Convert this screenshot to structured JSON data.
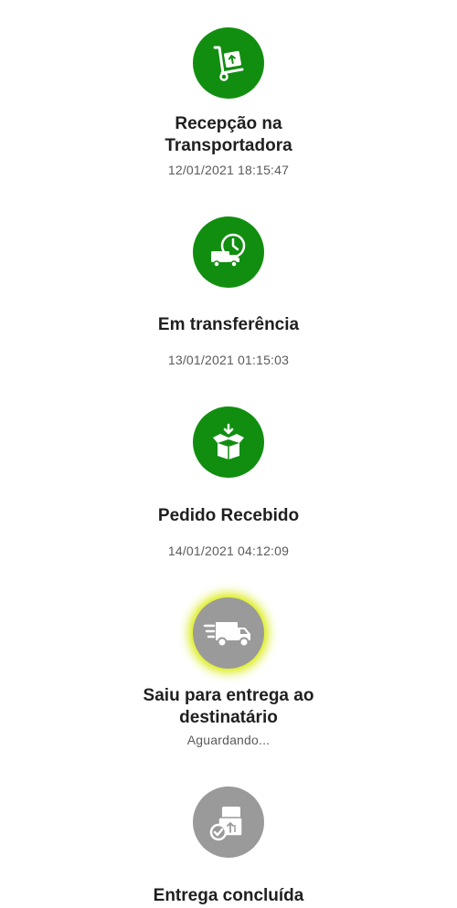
{
  "steps": [
    {
      "id": "reception",
      "icon": "hand-truck-package-icon",
      "status": "done",
      "title_line1": "Recepção na",
      "title_line2": "Transportadora",
      "date": "12/01/2021 18:15:47"
    },
    {
      "id": "transfer",
      "icon": "truck-clock-icon",
      "status": "done",
      "title_line1": "Em transferência",
      "title_line2": "",
      "date": "13/01/2021 01:15:03"
    },
    {
      "id": "received",
      "icon": "open-box-arrow-icon",
      "status": "done",
      "title_line1": "Pedido Recebido",
      "title_line2": "",
      "date": "14/01/2021 04:12:09"
    },
    {
      "id": "out-for-delivery",
      "icon": "delivery-van-icon",
      "status": "current",
      "title_line1": "Saiu para entrega ao",
      "title_line2": "destinatário",
      "date": "Aguardando..."
    },
    {
      "id": "delivered",
      "icon": "boxes-check-icon",
      "status": "pending",
      "title_line1": "Entrega concluída",
      "title_line2": "",
      "date": ""
    }
  ],
  "colors": {
    "done": "#118e10",
    "pending": "#9a9a9a",
    "current_glow": "#e0ee2a",
    "title": "#1f1f1f",
    "date": "#5a5a5a"
  }
}
